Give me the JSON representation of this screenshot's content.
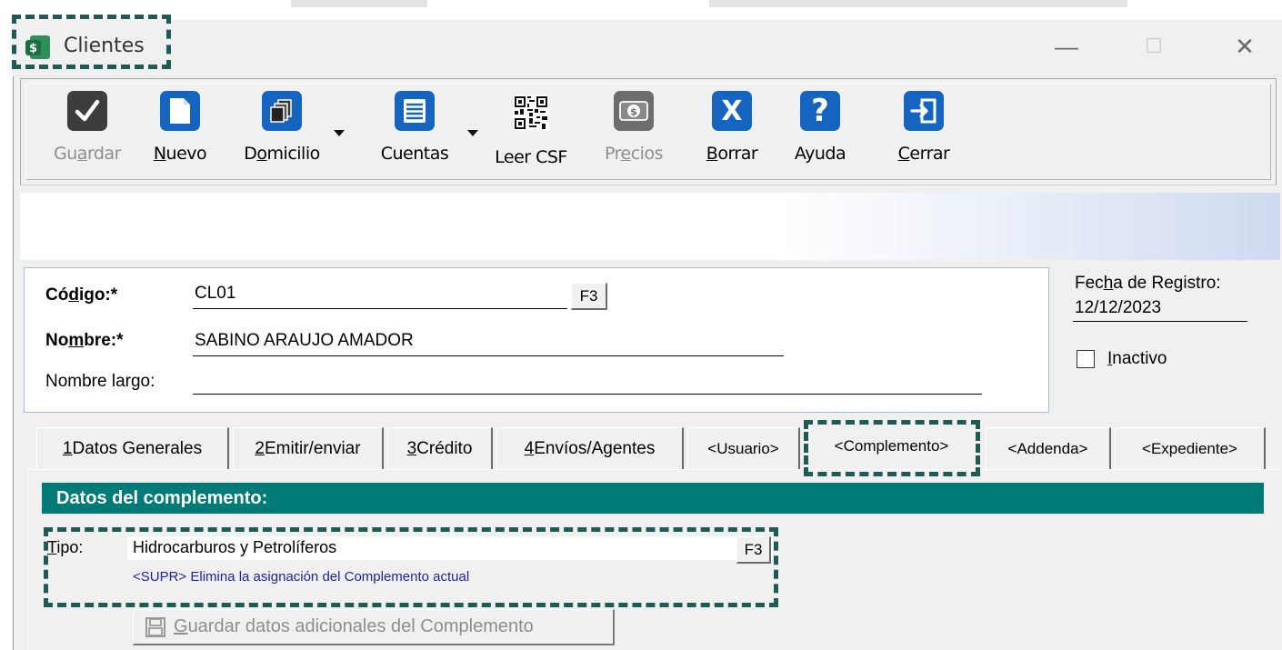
{
  "window": {
    "title": "Clientes",
    "controls": [
      "—",
      "☐",
      "✕"
    ]
  },
  "toolbar": {
    "buttons": [
      {
        "label": "Guardar",
        "mnemonic_index": 2,
        "disabled": true,
        "icon": "checkmark-icon"
      },
      {
        "label": "Nuevo",
        "mnemonic_index": 0,
        "disabled": false,
        "icon": "new-document-icon"
      },
      {
        "label": "Domicilio",
        "mnemonic_index": 1,
        "disabled": false,
        "icon": "address-book-icon",
        "has_dropdown": true
      },
      {
        "label": "Cuentas",
        "mnemonic_index": -1,
        "disabled": false,
        "icon": "list-icon",
        "has_dropdown": true
      },
      {
        "label": "Leer CSF",
        "mnemonic_index": -1,
        "disabled": false,
        "icon": "qr-code-icon"
      },
      {
        "label": "Precios",
        "mnemonic_index": 2,
        "disabled": true,
        "icon": "money-icon"
      },
      {
        "label": "Borrar",
        "mnemonic_index": 0,
        "disabled": false,
        "icon": "delete-x-icon"
      },
      {
        "label": "Ayuda",
        "mnemonic_index": -1,
        "disabled": false,
        "icon": "help-icon"
      },
      {
        "label": "Cerrar",
        "mnemonic_index": 0,
        "disabled": false,
        "icon": "exit-door-icon"
      }
    ]
  },
  "form": {
    "codigo_label_pre": "Có",
    "codigo_label_u": "d",
    "codigo_label_post": "igo:*",
    "codigo_value": "CL01",
    "codigo_lookup": "F3",
    "nombre_label_pre": "No",
    "nombre_label_u": "m",
    "nombre_label_post": "bre:*",
    "nombre_value": "SABINO ARAUJO AMADOR",
    "nombre_largo_label": "Nombre largo:",
    "nombre_largo_value": "",
    "fecha_label_pre": "Fec",
    "fecha_label_u": "h",
    "fecha_label_post": "a de Registro:",
    "fecha_value": "12/12/2023",
    "inactivo_label_u": "I",
    "inactivo_label_post": "nactivo",
    "inactivo_checked": false
  },
  "tabs": [
    {
      "num": "1",
      "label": " Datos Generales"
    },
    {
      "num": "2",
      "label": " Emitir/enviar"
    },
    {
      "num": "3",
      "label": " Crédito"
    },
    {
      "num": "4",
      "label": " Envíos/Agentes"
    },
    {
      "num": "",
      "label": "<Usuario>"
    },
    {
      "num": "",
      "label": "<Complemento>"
    },
    {
      "num": "",
      "label": "<Addenda>"
    },
    {
      "num": "",
      "label": "<Expediente>"
    }
  ],
  "complemento": {
    "section_title": "Datos del complemento:",
    "tipo_label_u": "T",
    "tipo_label_post": "ipo:",
    "tipo_value": "Hidrocarburos y Petrolíferos",
    "tipo_lookup": "F3",
    "hint": "<SUPR> Elimina la asignación del Complemento actual",
    "save_button_u": "G",
    "save_button_post": "uardar datos adicionales del Complemento"
  },
  "colors": {
    "accent_teal": "#007b77",
    "highlight_dash": "#1f5a54",
    "toolbar_blue": "#1565c0"
  }
}
